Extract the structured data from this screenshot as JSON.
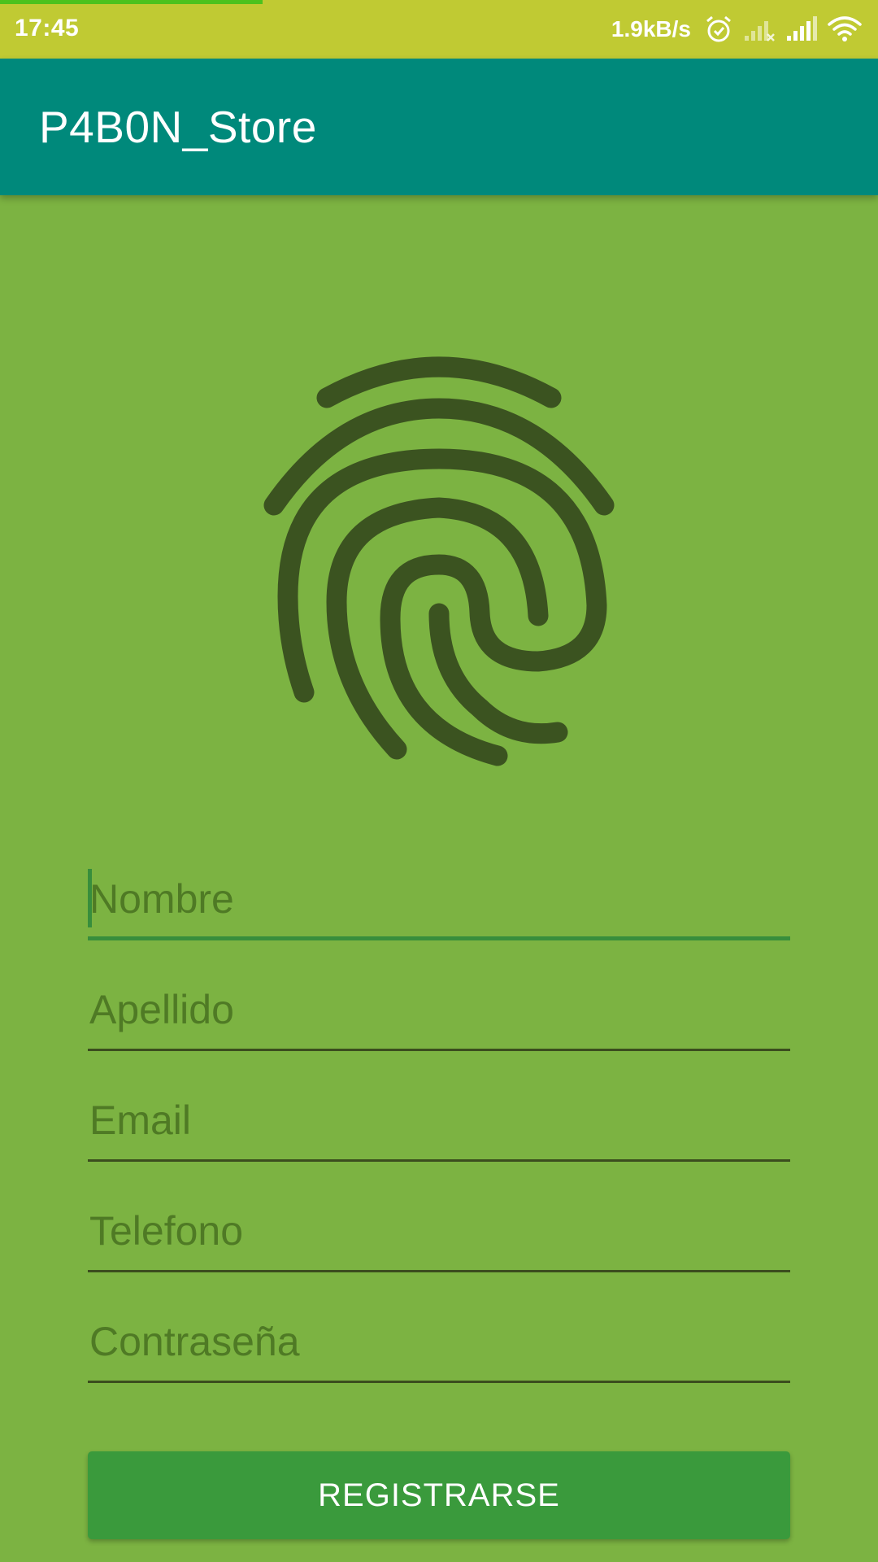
{
  "status_bar": {
    "time": "17:45",
    "network_speed": "1.9kB/s",
    "icons": [
      "alarm-icon",
      "signal-weak-icon",
      "signal-icon",
      "wifi-icon"
    ],
    "background_color": "#c0ca33"
  },
  "app_bar": {
    "title": "P4B0N_Store",
    "background_color": "#00897b"
  },
  "logo": {
    "icon": "fingerprint-icon",
    "color": "#3b5320"
  },
  "form": {
    "fields": [
      {
        "placeholder": "Nombre",
        "value": "",
        "focused": true
      },
      {
        "placeholder": "Apellido",
        "value": ""
      },
      {
        "placeholder": "Email",
        "value": ""
      },
      {
        "placeholder": "Telefono",
        "value": ""
      },
      {
        "placeholder": "Contraseña",
        "value": ""
      }
    ],
    "submit_label": "REGISTRARSE"
  },
  "colors": {
    "background": "#7cb342",
    "accent": "#388e3c",
    "button": "#3a9a3c"
  }
}
